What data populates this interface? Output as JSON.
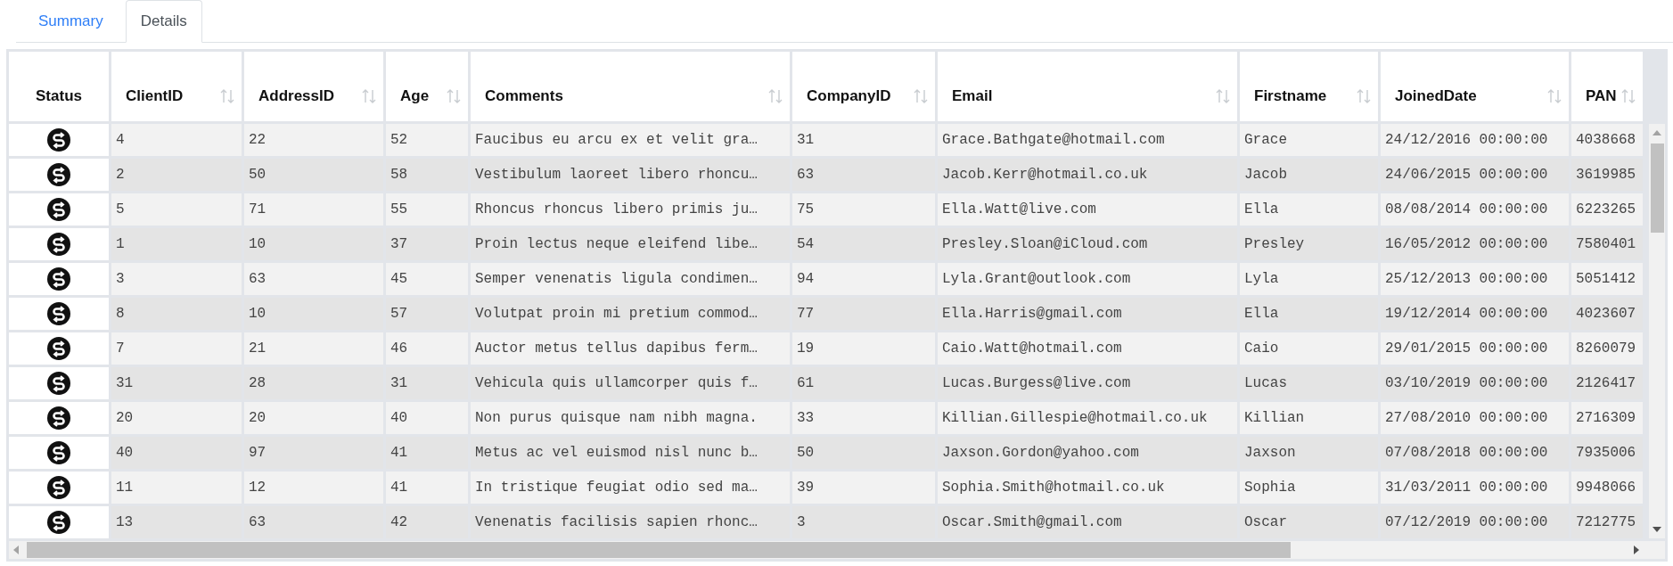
{
  "tabs": [
    {
      "label": "Summary",
      "selected": false
    },
    {
      "label": "Details",
      "selected": true
    }
  ],
  "table": {
    "columns": [
      {
        "label": "Status",
        "sortable": false
      },
      {
        "label": "ClientID",
        "sortable": true
      },
      {
        "label": "AddressID",
        "sortable": true
      },
      {
        "label": "Age",
        "sortable": true
      },
      {
        "label": "Comments",
        "sortable": true
      },
      {
        "label": "CompanyID",
        "sortable": true
      },
      {
        "label": "Email",
        "sortable": true
      },
      {
        "label": "Firstname",
        "sortable": true
      },
      {
        "label": "JoinedDate",
        "sortable": true
      },
      {
        "label": "PAN",
        "sortable": true
      }
    ],
    "rows": [
      {
        "cells": [
          "",
          "4",
          "22",
          "52",
          "Faucibus eu arcu ex et velit gra…",
          "31",
          "Grace.Bathgate@hotmail.com",
          "Grace",
          "24/12/2016 00:00:00",
          "4038668"
        ]
      },
      {
        "cells": [
          "",
          "2",
          "50",
          "58",
          "Vestibulum laoreet libero rhoncu…",
          "63",
          "Jacob.Kerr@hotmail.co.uk",
          "Jacob",
          "24/06/2015 00:00:00",
          "3619985"
        ]
      },
      {
        "cells": [
          "",
          "5",
          "71",
          "55",
          "Rhoncus rhoncus libero primis ju…",
          "75",
          "Ella.Watt@live.com",
          "Ella",
          "08/08/2014 00:00:00",
          "6223265"
        ]
      },
      {
        "cells": [
          "",
          "1",
          "10",
          "37",
          "Proin lectus neque eleifend libe…",
          "54",
          "Presley.Sloan@iCloud.com",
          "Presley",
          "16/05/2012 00:00:00",
          "7580401"
        ]
      },
      {
        "cells": [
          "",
          "3",
          "63",
          "45",
          "Semper venenatis ligula condimen…",
          "94",
          "Lyla.Grant@outlook.com",
          "Lyla",
          "25/12/2013 00:00:00",
          "5051412"
        ]
      },
      {
        "cells": [
          "",
          "8",
          "10",
          "57",
          "Volutpat proin mi pretium commod…",
          "77",
          "Ella.Harris@gmail.com",
          "Ella",
          "19/12/2014 00:00:00",
          "4023607"
        ]
      },
      {
        "cells": [
          "",
          "7",
          "21",
          "46",
          "Auctor metus tellus dapibus ferm…",
          "19",
          "Caio.Watt@hotmail.com",
          "Caio",
          "29/01/2015 00:00:00",
          "8260079"
        ]
      },
      {
        "cells": [
          "",
          "31",
          "28",
          "31",
          "Vehicula quis ullamcorper quis f…",
          "61",
          "Lucas.Burgess@live.com",
          "Lucas",
          "03/10/2019 00:00:00",
          "2126417"
        ]
      },
      {
        "cells": [
          "",
          "20",
          "20",
          "40",
          "Non purus quisque nam nibh magna.",
          "33",
          "Killian.Gillespie@hotmail.co.uk",
          "Killian",
          "27/08/2010 00:00:00",
          "2716309"
        ]
      },
      {
        "cells": [
          "",
          "40",
          "97",
          "41",
          "Metus ac vel euismod nisl nunc b…",
          "50",
          "Jaxson.Gordon@yahoo.com",
          "Jaxson",
          "07/08/2018 00:00:00",
          "7935006"
        ]
      },
      {
        "cells": [
          "",
          "11",
          "12",
          "41",
          "In tristique feugiat odio sed ma…",
          "39",
          "Sophia.Smith@hotmail.co.uk",
          "Sophia",
          "31/03/2011 00:00:00",
          "9948066"
        ]
      },
      {
        "cells": [
          "",
          "13",
          "63",
          "42",
          "Venenatis facilisis sapien rhonc…",
          "3",
          "Oscar.Smith@gmail.com",
          "Oscar",
          "07/12/2019 00:00:00",
          "7212775"
        ]
      }
    ]
  }
}
